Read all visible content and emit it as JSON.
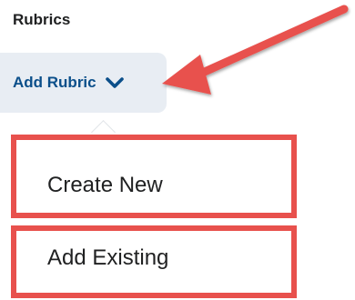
{
  "section": {
    "title": "Rubrics"
  },
  "add_rubric": {
    "label": "Add Rubric",
    "icon": "chevron-down-icon"
  },
  "menu": {
    "items": [
      {
        "label": "Create New"
      },
      {
        "label": "Add Existing"
      }
    ]
  },
  "annotation": {
    "highlight_color": "#e8514d",
    "arrow_color": "#e8514d"
  },
  "colors": {
    "button_bg": "#e8edf3",
    "button_text": "#0b4f8a",
    "text": "#202122"
  }
}
